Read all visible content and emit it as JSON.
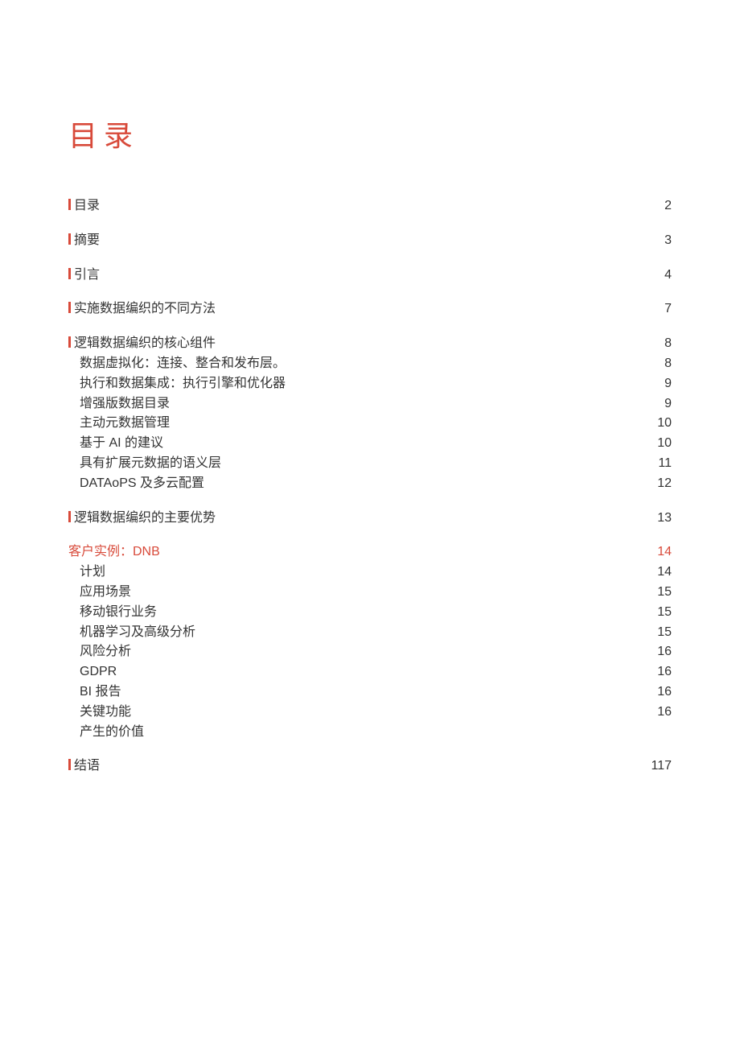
{
  "title": "目录",
  "sections": [
    {
      "items": [
        {
          "label": "目录",
          "page": "2",
          "type": "main",
          "bar": true
        }
      ]
    },
    {
      "items": [
        {
          "label": "摘要",
          "page": "3",
          "type": "main",
          "bar": true
        }
      ]
    },
    {
      "items": [
        {
          "label": "引言",
          "page": "4",
          "type": "main",
          "bar": true
        }
      ]
    },
    {
      "items": [
        {
          "label": "实施数据编织的不同方法",
          "page": "7",
          "type": "main",
          "bar": true
        }
      ]
    },
    {
      "items": [
        {
          "label": "逻辑数据编织的核心组件",
          "page": "8",
          "type": "main",
          "bar": true
        },
        {
          "label": "数据虚拟化：连接、整合和发布层。",
          "page": "8",
          "type": "sub"
        },
        {
          "label": "执行和数据集成：执行引擎和优化器",
          "page": "9",
          "type": "sub"
        },
        {
          "label": "增强版数据目录",
          "page": "9",
          "type": "sub"
        },
        {
          "label": "主动元数据管理",
          "page": "10",
          "type": "sub"
        },
        {
          "label": "基于 AI 的建议",
          "page": "10",
          "type": "sub"
        },
        {
          "label": "具有扩展元数据的语义层",
          "page": "11",
          "type": "sub"
        },
        {
          "label": "DATAoPS 及多云配置",
          "page": "12",
          "type": "sub"
        }
      ]
    },
    {
      "items": [
        {
          "label": "逻辑数据编织的主要优势",
          "page": "13",
          "type": "main",
          "bar": true
        }
      ]
    },
    {
      "items": [
        {
          "label": "客户实例：DNB",
          "page": "14",
          "type": "link"
        },
        {
          "label": "计划",
          "page": "14",
          "type": "sub"
        },
        {
          "label": "应用场景",
          "page": "15",
          "type": "sub"
        },
        {
          "label": "移动银行业务",
          "page": "15",
          "type": "sub"
        },
        {
          "label": "机器学习及高级分析",
          "page": "15",
          "type": "sub"
        },
        {
          "label": "风险分析",
          "page": "16",
          "type": "sub"
        },
        {
          "label": "GDPR",
          "page": "16",
          "type": "sub"
        },
        {
          "label": "BI 报告",
          "page": "16",
          "type": "sub"
        },
        {
          "label": "关键功能",
          "page": "16",
          "type": "sub"
        },
        {
          "label": "产生的价值",
          "page": "",
          "type": "sub"
        }
      ]
    },
    {
      "items": [
        {
          "label": "结语",
          "page": "117",
          "type": "main",
          "bar": true
        }
      ]
    }
  ]
}
